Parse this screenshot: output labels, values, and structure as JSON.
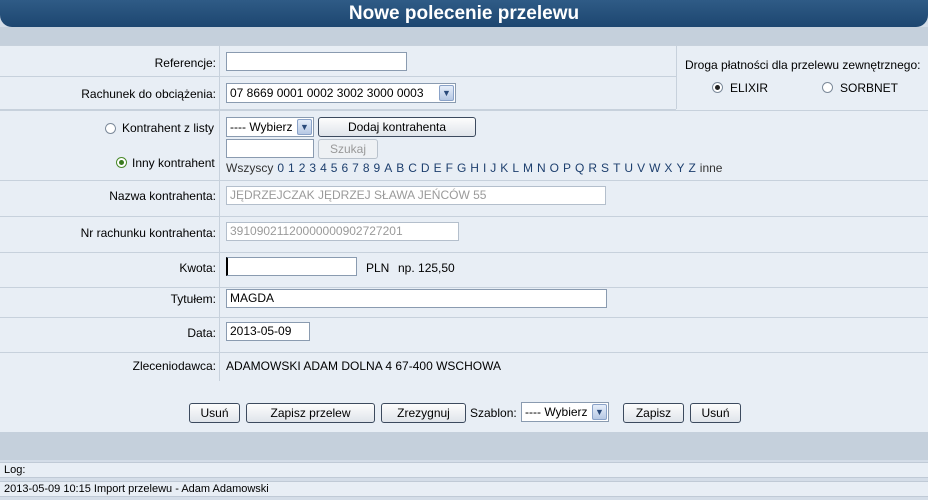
{
  "title": "Nowe polecenie przelewu",
  "fields": {
    "referencje_label": "Referencje:",
    "referencje_value": "",
    "rachunek_label": "Rachunek do obciążenia:",
    "rachunek_value": "07 8669 0001 0002 3002 3000 0003",
    "kontrahent_z_listy_label": "Kontrahent z listy",
    "wybierz_value": "---- Wybierz",
    "dodaj_kontrahenta": "Dodaj kontrahenta",
    "szukaj": "Szukaj",
    "inny_kontrahent_label": "Inny kontrahent",
    "nazwa_label": "Nazwa kontrahenta:",
    "nazwa_value": "JĘDRZEJCZAK JĘDRZEJ SŁAWA JEŃCÓW 55",
    "nr_rachunku_label": "Nr rachunku kontrahenta:",
    "nr_rachunku_value": "39109021120000000902727201",
    "kwota_label": "Kwota:",
    "kwota_value": "",
    "waluta": "PLN",
    "kwota_hint": "np. 125,50",
    "tytul_label": "Tytułem:",
    "tytul_value": "MAGDA",
    "data_label": "Data:",
    "data_value": "2013-05-09",
    "zleceniodawca_label": "Zleceniodawca:",
    "zleceniodawca_value": "ADAMOWSKI ADAM DOLNA 4 67-400 WSCHOWA"
  },
  "alphabet": [
    "Wszyscy",
    "0",
    "1",
    "2",
    "3",
    "4",
    "5",
    "6",
    "7",
    "8",
    "9",
    "A",
    "B",
    "C",
    "D",
    "E",
    "F",
    "G",
    "H",
    "I",
    "J",
    "K",
    "L",
    "M",
    "N",
    "O",
    "P",
    "Q",
    "R",
    "S",
    "T",
    "U",
    "V",
    "W",
    "X",
    "Y",
    "Z",
    "inne"
  ],
  "payment_route": {
    "label": "Droga płatności dla przelewu zewnętrznego:",
    "elixir": "ELIXIR",
    "sorbnet": "SORBNET",
    "selected": "ELIXIR"
  },
  "actions": {
    "usun": "Usuń",
    "zapisz_przelew": "Zapisz przelew",
    "zrezygnuj": "Zrezygnuj",
    "szablon_label": "Szablon:",
    "szablon_value": "---- Wybierz",
    "zapisz": "Zapisz",
    "usun2": "Usuń"
  },
  "log": {
    "label": "Log:",
    "entry": "2013-05-09 10:15 Import przelewu - Adam Adamowski"
  }
}
